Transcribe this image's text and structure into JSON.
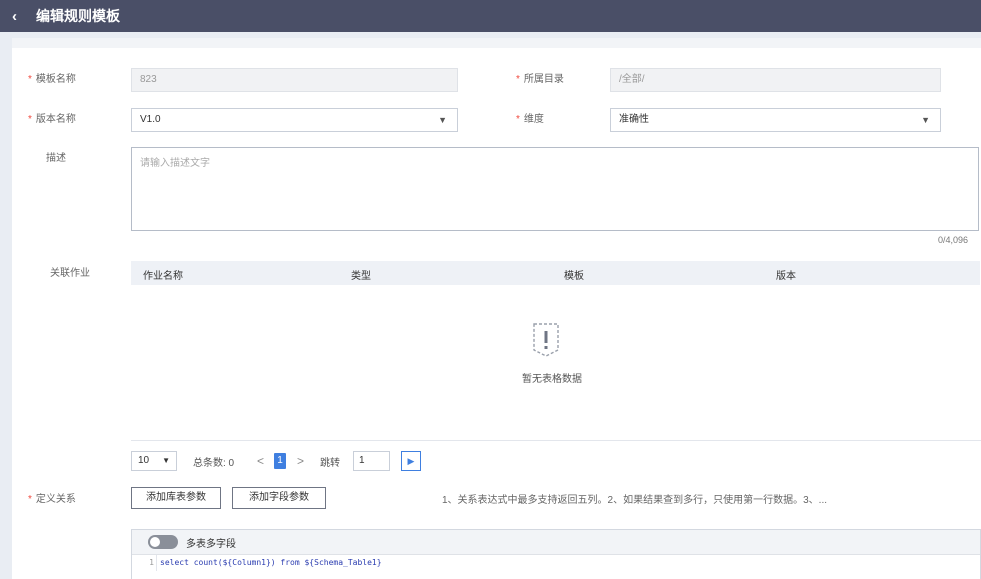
{
  "header": {
    "title": "编辑规则模板"
  },
  "form": {
    "template_name": {
      "label": "模板名称",
      "value": "823"
    },
    "directory": {
      "label": "所属目录",
      "value": "/全部/"
    },
    "version": {
      "label": "版本名称",
      "value": "V1.0"
    },
    "dimension": {
      "label": "维度",
      "value": "准确性"
    },
    "description": {
      "label": "描述",
      "placeholder": "请输入描述文字",
      "counter": "0/4,096"
    }
  },
  "jobs": {
    "label": "关联作业",
    "columns": [
      "作业名称",
      "类型",
      "模板",
      "版本"
    ],
    "empty_text": "暂无表格数据"
  },
  "pagination": {
    "page_size": "10",
    "total_label": "总条数: 0",
    "prev": "<",
    "current": "1",
    "next": ">",
    "jump_label": "跳转",
    "jump_value": "1"
  },
  "relation": {
    "label": "定义关系",
    "add_table_param": "添加库表参数",
    "add_field_param": "添加字段参数",
    "hint": "1、关系表达式中最多支持返回五列。2、如果结果查到多行，只使用第一行数据。3、...",
    "toggle_label": "多表多字段",
    "code_line_number": "1",
    "code": "select count(${Column1}) from ${Schema_Table1}"
  }
}
